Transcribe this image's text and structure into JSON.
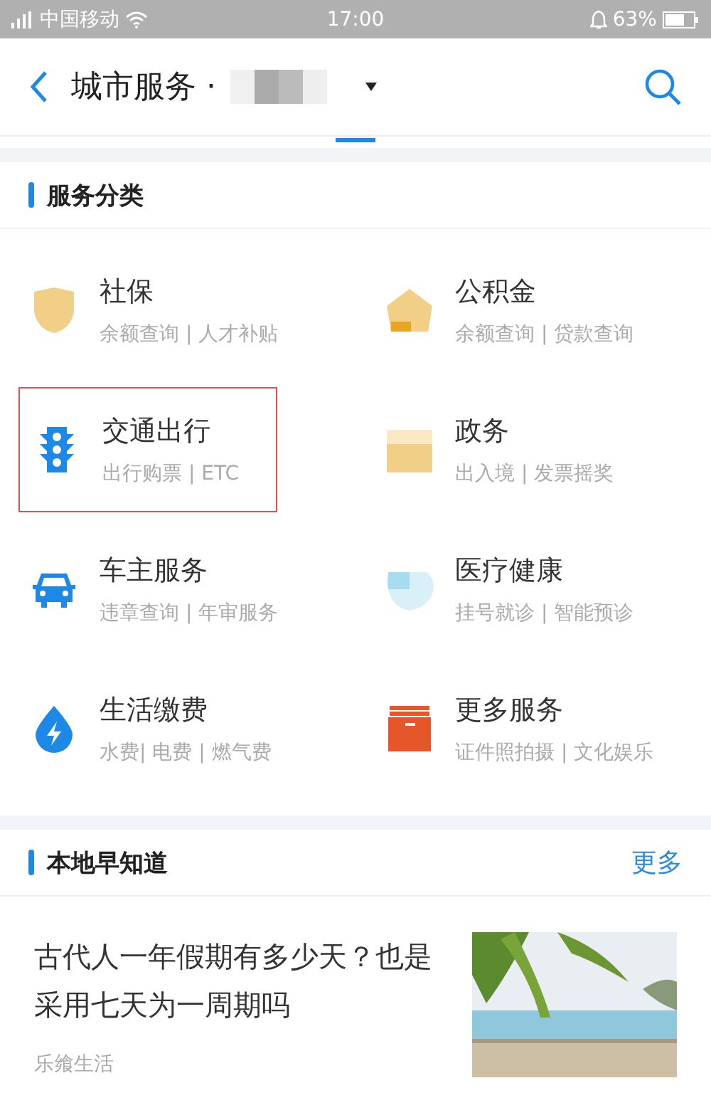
{
  "status_bar": {
    "carrier": "中国移动",
    "time": "17:00",
    "battery": "63%"
  },
  "header": {
    "title": "城市服务 ·"
  },
  "services": {
    "title": "服务分类",
    "items": [
      {
        "name": "社保",
        "desc": "余额查询 | 人才补贴",
        "kind": "shield",
        "highlighted": false
      },
      {
        "name": "公积金",
        "desc": "余额查询 | 贷款查询",
        "kind": "house",
        "highlighted": false
      },
      {
        "name": "交通出行",
        "desc": "出行购票 | ETC",
        "kind": "traffic",
        "highlighted": true
      },
      {
        "name": "政务",
        "desc": "出入境 | 发票摇奖",
        "kind": "folder",
        "highlighted": false
      },
      {
        "name": "车主服务",
        "desc": "违章查询 | 年审服务",
        "kind": "car",
        "highlighted": false
      },
      {
        "name": "医疗健康",
        "desc": "挂号就诊 | 智能预诊",
        "kind": "cloud",
        "highlighted": false
      },
      {
        "name": "生活缴费",
        "desc": "水费| 电费 | 燃气费",
        "kind": "drop",
        "highlighted": false
      },
      {
        "name": "更多服务",
        "desc": "证件照拍摄 | 文化娱乐",
        "kind": "box",
        "highlighted": false
      }
    ]
  },
  "news": {
    "title": "本地早知道",
    "more": "更多",
    "articles": [
      {
        "title": "古代人一年假期有多少天？也是采用七天为一周期吗",
        "source": "乐飨生活"
      }
    ]
  }
}
